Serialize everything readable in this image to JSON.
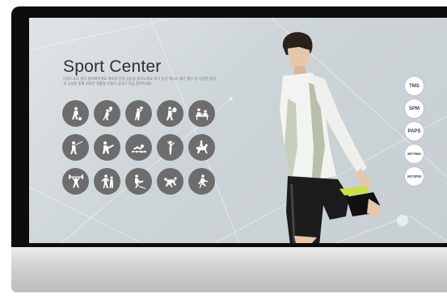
{
  "page": {
    "title": "Sport Center",
    "description": "다양스포츠 센터 참여해주세요 체육과 건강 운동을 즐겨보세요 축구 농구 테니스 배구 헬스 등 다양한 종목과 시설을 통해 건강한 생활을 만들어 갑니다 지금 참여하세요"
  },
  "sports": [
    {
      "icon": "soccer-icon"
    },
    {
      "icon": "volleyball-icon"
    },
    {
      "icon": "basketball-icon"
    },
    {
      "icon": "tennis-icon"
    },
    {
      "icon": "table-tennis-icon"
    },
    {
      "icon": "fencing-icon"
    },
    {
      "icon": "taekwondo-icon"
    },
    {
      "icon": "swimming-icon"
    },
    {
      "icon": "gymnastics-icon"
    },
    {
      "icon": "equestrian-icon"
    },
    {
      "icon": "weightlifting-icon"
    },
    {
      "icon": "judo-icon"
    },
    {
      "icon": "rowing-icon"
    },
    {
      "icon": "wrestling-icon"
    },
    {
      "icon": "running-icon"
    }
  ],
  "menu": [
    "TMS",
    "SPM",
    "PAPS",
    "MYTMS",
    "MYSPM"
  ],
  "colors": {
    "screen_bg": "#d6dcdf",
    "icon_circle": "#6d6d6d",
    "menu_circle": "#ffffff",
    "bezel": "#0d0d0d"
  }
}
